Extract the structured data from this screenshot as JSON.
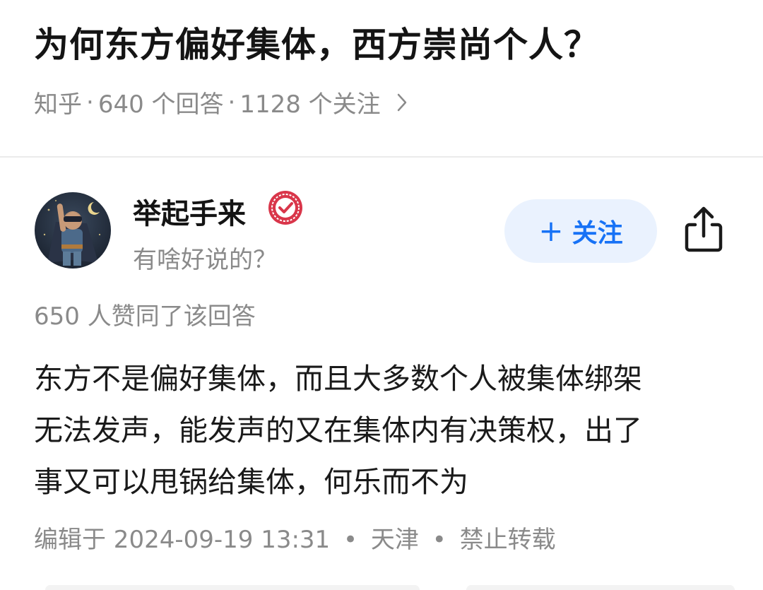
{
  "question": {
    "title": "为何东方偏好集体，西方崇尚个人？",
    "source": "知乎",
    "answers": "640 个回答",
    "followers": "1128 个关注"
  },
  "author": {
    "name": "举起手来",
    "bio": "有啥好说的？",
    "follow_label": "关注"
  },
  "answer": {
    "likes": "650 人赞同了该回答",
    "lines": [
      "东方不是偏好集体，而且大多数个人被集体绑架",
      "无法发声，能发声的又在集体内有决策权，出了",
      "事又可以甩锅给集体，何乐而不为"
    ],
    "edited": "编辑于 2024-09-19 13:31",
    "location": "天津",
    "copyright": "禁止转载"
  },
  "icons": {
    "verified": "verified-badge-icon",
    "share": "share-icon",
    "chevron": "chevron-right-icon",
    "plus": "plus-icon"
  },
  "colors": {
    "accent": "#1772f6",
    "follow_bg": "#eaf2fe",
    "badge": "#d9364a",
    "muted_text": "#8a8a8a"
  }
}
